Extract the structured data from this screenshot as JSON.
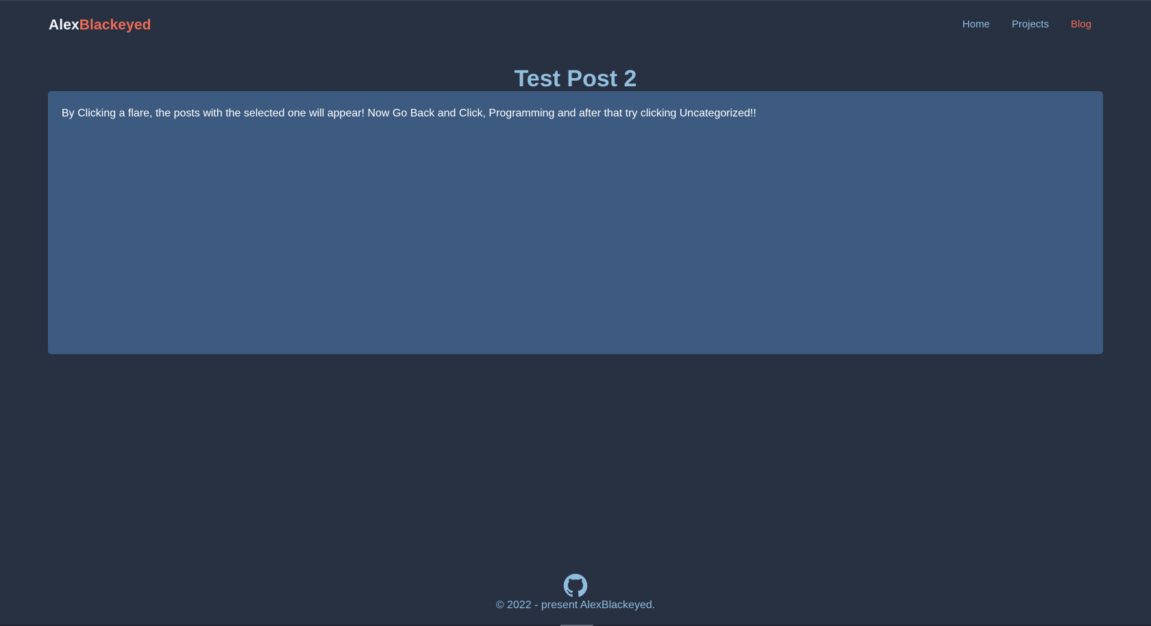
{
  "header": {
    "brand": {
      "first": "Alex",
      "second": "Blackeyed"
    },
    "nav": [
      {
        "label": "Home"
      },
      {
        "label": "Projects"
      },
      {
        "label": "Blog"
      }
    ]
  },
  "post": {
    "title": "Test Post 2",
    "body": "By Clicking a flare, the posts with the selected one will appear! Now Go Back and Click, Programming and after that try clicking Uncategorized!!"
  },
  "footer": {
    "icon": "github-icon",
    "copyright": "© 2022 - present AlexBlackeyed."
  },
  "colors": {
    "background": "#283142",
    "card": "#3d5b80",
    "accent": "#ef6b55",
    "link": "#8ebddf",
    "title": "#92bfdd"
  }
}
